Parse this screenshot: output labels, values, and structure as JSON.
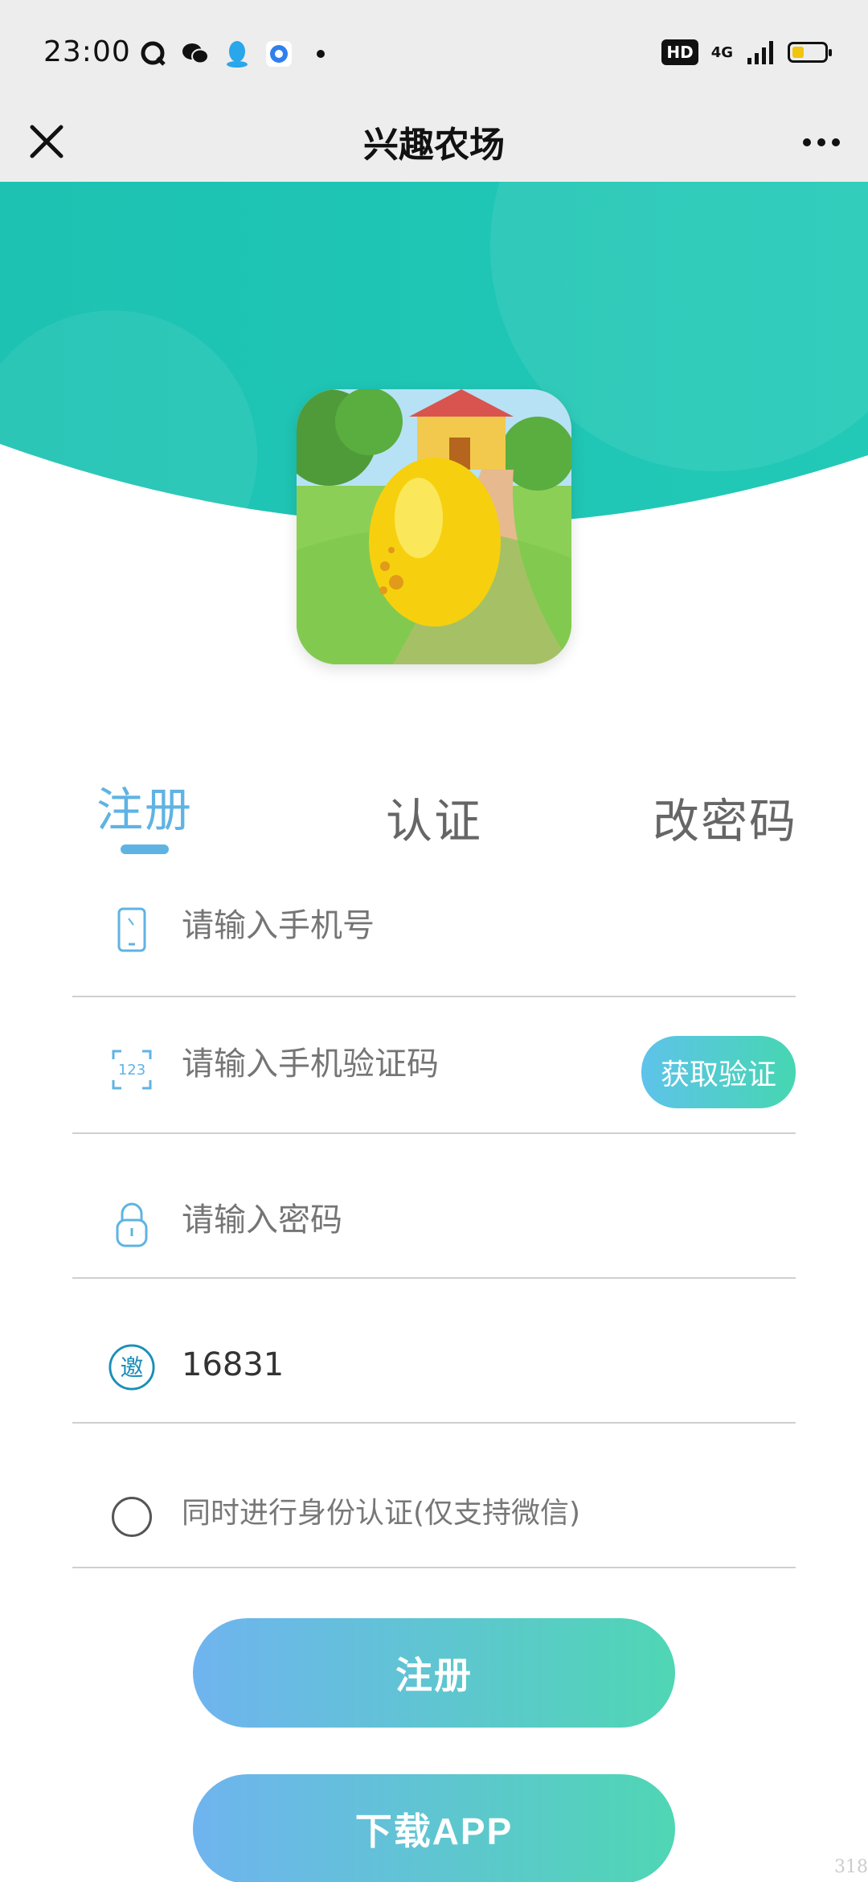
{
  "status_bar": {
    "time": "23:00",
    "hd_label": "HD",
    "network_label": "4G",
    "left_icons": [
      "search-app-icon",
      "wechat-icon",
      "qq-icon",
      "browser-icon",
      "dot-icon"
    ]
  },
  "nav": {
    "title": "兴趣农场",
    "close_icon": "close-icon",
    "more_icon": "more-icon"
  },
  "colors": {
    "hero_teal": "#1fc9b6",
    "accent_blue": "#5fb3e3",
    "button_gradient_start": "#6fb4ef",
    "button_gradient_end": "#4fd6b4"
  },
  "tabs": [
    {
      "label": "注册",
      "active": true
    },
    {
      "label": "认证",
      "active": false
    },
    {
      "label": "改密码",
      "active": false
    }
  ],
  "form": {
    "phone_placeholder": "请输入手机号",
    "code_placeholder": "请输入手机验证码",
    "get_code_label": "获取验证",
    "code_icon_text": "123",
    "password_placeholder": "请输入密码",
    "invite_icon_text": "邀",
    "invite_value": "16831",
    "verify_option_label": "同时进行身份认证(仅支持微信)"
  },
  "buttons": {
    "register": "注册",
    "download": "下载APP"
  },
  "watermark": "318"
}
